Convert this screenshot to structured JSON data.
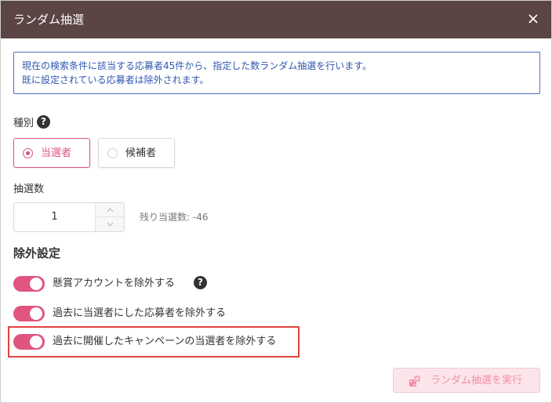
{
  "dialog": {
    "title": "ランダム抽選",
    "close_icon": "close-icon"
  },
  "info": {
    "line1": "現在の検索条件に該当する応募者45件から、指定した数ランダム抽選を行います。",
    "line2": "既に設定されている応募者は除外されます。"
  },
  "type_section": {
    "label": "種別",
    "help_icon": "?",
    "options": [
      {
        "label": "当選者",
        "selected": true
      },
      {
        "label": "候補者",
        "selected": false
      }
    ]
  },
  "count_section": {
    "label": "抽選数",
    "value": "1",
    "remaining": "残り当選数: -46"
  },
  "exclusion": {
    "title": "除外設定",
    "help_icon": "?",
    "toggles": [
      {
        "label": "懸賞アカウントを除外する",
        "on": true
      },
      {
        "label": "過去に当選者にした応募者を除外する",
        "on": true
      },
      {
        "label": "過去に開催したキャンペーンの当選者を除外する",
        "on": true
      }
    ]
  },
  "run_button": {
    "label": "ランダム抽選を実行",
    "icon": "dice-icon",
    "disabled": true
  },
  "colors": {
    "titlebar": "#5b4444",
    "accent": "#d9557f",
    "info_border": "#4a6fc0",
    "highlight": "#e0443e"
  }
}
